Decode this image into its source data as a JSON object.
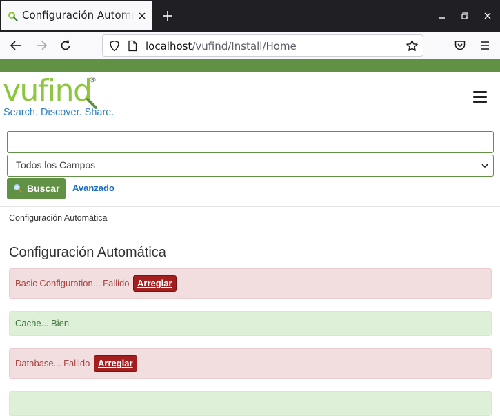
{
  "browser": {
    "tab_title": "Configuración Automática",
    "favicon": "vufind-lens-icon",
    "url_host": "localhost",
    "url_path": "/vufind/Install/Home"
  },
  "colors": {
    "brand_green": "#619144",
    "logo_green": "#8dc63f",
    "logo_blue": "#2a7fc1",
    "danger_bg": "#f2dede",
    "danger_border": "#ebccd1",
    "danger_text": "#a94442",
    "danger_button": "#a31f1f",
    "success_bg": "#dff0d8",
    "success_border": "#d6e9c6",
    "success_text": "#3c763d",
    "link": "#1b6dc1"
  },
  "header": {
    "logo_text": "vufind",
    "logo_registered": "®",
    "tagline": "Search. Discover. Share.",
    "menu_icon": "hamburger-menu-icon"
  },
  "search": {
    "input_value": "",
    "select_value": "Todos los Campos",
    "button_label": "Buscar",
    "button_icon": "search-icon",
    "advanced_label": "Avanzado"
  },
  "breadcrumb": "Configuración Automática",
  "main": {
    "title": "Configuración Automática",
    "checks": [
      {
        "text": "Basic Configuration... Fallido",
        "status": "fail",
        "fix_label": "Arreglar"
      },
      {
        "text": "Cache... Bien",
        "status": "ok"
      },
      {
        "text": "Database... Fallido",
        "status": "fail",
        "fix_label": "Arreglar"
      }
    ]
  }
}
